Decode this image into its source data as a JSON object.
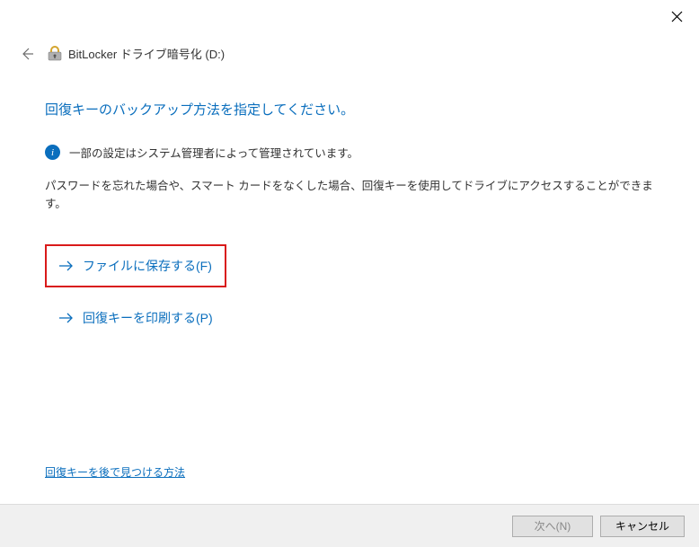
{
  "header": {
    "title": "BitLocker ドライブ暗号化 (D:)"
  },
  "main": {
    "heading": "回復キーのバックアップ方法を指定してください。",
    "infoText": "一部の設定はシステム管理者によって管理されています。",
    "description": "パスワードを忘れた場合や、スマート カードをなくした場合、回復キーを使用してドライブにアクセスすることができます。"
  },
  "options": {
    "saveToFile": "ファイルに保存する(F)",
    "printKey": "回復キーを印刷する(P)"
  },
  "helpLink": {
    "label": "回復キーを後で見つける方法"
  },
  "buttons": {
    "next": "次へ(N)",
    "cancel": "キャンセル"
  },
  "colors": {
    "accent": "#0a6ebd",
    "highlight": "#d91a1a"
  }
}
